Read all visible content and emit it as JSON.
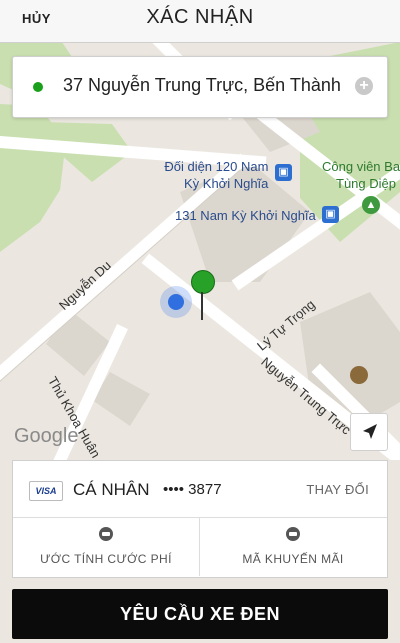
{
  "header": {
    "cancel": "HỦY",
    "title": "XÁC NHẬN"
  },
  "pickup": {
    "address": "37 Nguyễn Trung Trực, Bến Thành"
  },
  "map": {
    "labels": {
      "poi_1_line1": "Đối diện 120 Nam",
      "poi_1_line2": "Kỳ Khởi Nghĩa",
      "poi_2": "131 Nam Kỳ Khởi Nghĩa",
      "park_line1": "Công viên Ba",
      "park_line2": "Tùng Diệp",
      "road_nguyen_du": "Nguyễn Du",
      "road_ly_tu_trong": "Lý Tự Trọng",
      "road_nguyen_trung_truc": "Nguyễn Trung Trực",
      "road_thu_khoa_huan": "Thủ Khoa Huân",
      "google": "Google"
    }
  },
  "payment": {
    "brand": "VISA",
    "name": "CÁ NHÂN",
    "card": "•••• 3877",
    "change": "THAY ĐỔI"
  },
  "options": {
    "estimate": "ƯỚC TÍNH CƯỚC PHÍ",
    "promo": "MÃ KHUYẾN MÃI"
  },
  "cta": {
    "label": "YÊU CẦU XE ĐEN"
  }
}
